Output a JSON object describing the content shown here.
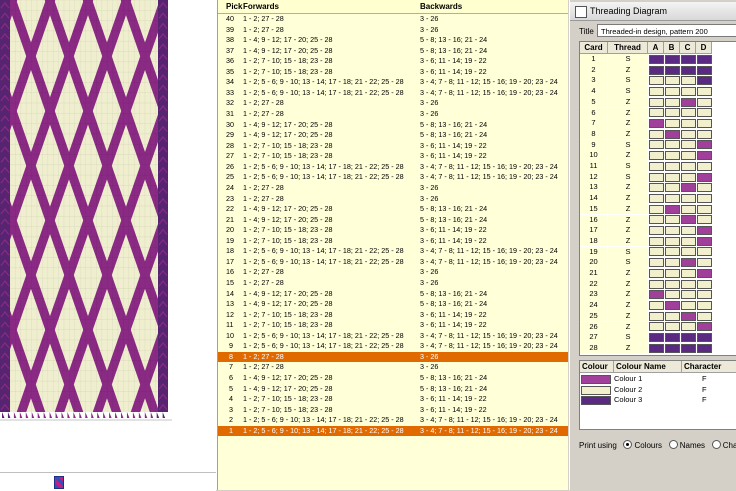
{
  "pattern": {
    "colors": {
      "purple": "#8a2a84",
      "cream": "#efefcf",
      "darkPurple": "#562470",
      "outline": "#5a2050"
    }
  },
  "picks_header": {
    "pick": "Pick",
    "forwards": "Forwards",
    "backwards": "Backwards"
  },
  "picks": [
    {
      "pick": "40",
      "fw": "1 - 2; 27 - 28",
      "bw": "3 - 26",
      "selected": false
    },
    {
      "pick": "39",
      "fw": "1 - 2; 27 - 28",
      "bw": "3 - 26",
      "selected": false
    },
    {
      "pick": "38",
      "fw": "1 - 4; 9 - 12; 17 - 20; 25 - 28",
      "bw": "5 - 8; 13 - 16; 21 - 24",
      "selected": false
    },
    {
      "pick": "37",
      "fw": "1 - 4; 9 - 12; 17 - 20; 25 - 28",
      "bw": "5 - 8; 13 - 16; 21 - 24",
      "selected": false
    },
    {
      "pick": "36",
      "fw": "1 - 2; 7 - 10; 15 - 18; 23 - 28",
      "bw": "3 - 6; 11 - 14; 19 - 22",
      "selected": false
    },
    {
      "pick": "35",
      "fw": "1 - 2; 7 - 10; 15 - 18; 23 - 28",
      "bw": "3 - 6; 11 - 14; 19 - 22",
      "selected": false
    },
    {
      "pick": "34",
      "fw": "1 - 2; 5 - 6; 9 - 10; 13 - 14; 17 - 18; 21 - 22; 25 - 28",
      "bw": "3 - 4; 7 - 8; 11 - 12; 15 - 16; 19 - 20; 23 - 24",
      "selected": false
    },
    {
      "pick": "33",
      "fw": "1 - 2; 5 - 6; 9 - 10; 13 - 14; 17 - 18; 21 - 22; 25 - 28",
      "bw": "3 - 4; 7 - 8; 11 - 12; 15 - 16; 19 - 20; 23 - 24",
      "selected": false
    },
    {
      "pick": "32",
      "fw": "1 - 2; 27 - 28",
      "bw": "3 - 26",
      "selected": false
    },
    {
      "pick": "31",
      "fw": "1 - 2; 27 - 28",
      "bw": "3 - 26",
      "selected": false
    },
    {
      "pick": "30",
      "fw": "1 - 4; 9 - 12; 17 - 20; 25 - 28",
      "bw": "5 - 8; 13 - 16; 21 - 24",
      "selected": false
    },
    {
      "pick": "29",
      "fw": "1 - 4; 9 - 12; 17 - 20; 25 - 28",
      "bw": "5 - 8; 13 - 16; 21 - 24",
      "selected": false
    },
    {
      "pick": "28",
      "fw": "1 - 2; 7 - 10; 15 - 18; 23 - 28",
      "bw": "3 - 6; 11 - 14; 19 - 22",
      "selected": false
    },
    {
      "pick": "27",
      "fw": "1 - 2; 7 - 10; 15 - 18; 23 - 28",
      "bw": "3 - 6; 11 - 14; 19 - 22",
      "selected": false
    },
    {
      "pick": "26",
      "fw": "1 - 2; 5 - 6; 9 - 10; 13 - 14; 17 - 18; 21 - 22; 25 - 28",
      "bw": "3 - 4; 7 - 8; 11 - 12; 15 - 16; 19 - 20; 23 - 24",
      "selected": false
    },
    {
      "pick": "25",
      "fw": "1 - 2; 5 - 6; 9 - 10; 13 - 14; 17 - 18; 21 - 22; 25 - 28",
      "bw": "3 - 4; 7 - 8; 11 - 12; 15 - 16; 19 - 20; 23 - 24",
      "selected": false
    },
    {
      "pick": "24",
      "fw": "1 - 2; 27 - 28",
      "bw": "3 - 26",
      "selected": false
    },
    {
      "pick": "23",
      "fw": "1 - 2; 27 - 28",
      "bw": "3 - 26",
      "selected": false
    },
    {
      "pick": "22",
      "fw": "1 - 4; 9 - 12; 17 - 20; 25 - 28",
      "bw": "5 - 8; 13 - 16; 21 - 24",
      "selected": false
    },
    {
      "pick": "21",
      "fw": "1 - 4; 9 - 12; 17 - 20; 25 - 28",
      "bw": "5 - 8; 13 - 16; 21 - 24",
      "selected": false
    },
    {
      "pick": "20",
      "fw": "1 - 2; 7 - 10; 15 - 18; 23 - 28",
      "bw": "3 - 6; 11 - 14; 19 - 22",
      "selected": false
    },
    {
      "pick": "19",
      "fw": "1 - 2; 7 - 10; 15 - 18; 23 - 28",
      "bw": "3 - 6; 11 - 14; 19 - 22",
      "selected": false
    },
    {
      "pick": "18",
      "fw": "1 - 2; 5 - 6; 9 - 10; 13 - 14; 17 - 18; 21 - 22; 25 - 28",
      "bw": "3 - 4; 7 - 8; 11 - 12; 15 - 16; 19 - 20; 23 - 24",
      "selected": false
    },
    {
      "pick": "17",
      "fw": "1 - 2; 5 - 6; 9 - 10; 13 - 14; 17 - 18; 21 - 22; 25 - 28",
      "bw": "3 - 4; 7 - 8; 11 - 12; 15 - 16; 19 - 20; 23 - 24",
      "selected": false
    },
    {
      "pick": "16",
      "fw": "1 - 2; 27 - 28",
      "bw": "3 - 26",
      "selected": false
    },
    {
      "pick": "15",
      "fw": "1 - 2; 27 - 28",
      "bw": "3 - 26",
      "selected": false
    },
    {
      "pick": "14",
      "fw": "1 - 4; 9 - 12; 17 - 20; 25 - 28",
      "bw": "5 - 8; 13 - 16; 21 - 24",
      "selected": false
    },
    {
      "pick": "13",
      "fw": "1 - 4; 9 - 12; 17 - 20; 25 - 28",
      "bw": "5 - 8; 13 - 16; 21 - 24",
      "selected": false
    },
    {
      "pick": "12",
      "fw": "1 - 2; 7 - 10; 15 - 18; 23 - 28",
      "bw": "3 - 6; 11 - 14; 19 - 22",
      "selected": false
    },
    {
      "pick": "11",
      "fw": "1 - 2; 7 - 10; 15 - 18; 23 - 28",
      "bw": "3 - 6; 11 - 14; 19 - 22",
      "selected": false
    },
    {
      "pick": "10",
      "fw": "1 - 2; 5 - 6; 9 - 10; 13 - 14; 17 - 18; 21 - 22; 25 - 28",
      "bw": "3 - 4; 7 - 8; 11 - 12; 15 - 16; 19 - 20; 23 - 24",
      "selected": false
    },
    {
      "pick": "9",
      "fw": "1 - 2; 5 - 6; 9 - 10; 13 - 14; 17 - 18; 21 - 22; 25 - 28",
      "bw": "3 - 4; 7 - 8; 11 - 12; 15 - 16; 19 - 20; 23 - 24",
      "selected": false
    },
    {
      "pick": "8",
      "fw": "1 - 2; 27 - 28",
      "bw": "3 - 26",
      "selected": true
    },
    {
      "pick": "7",
      "fw": "1 - 2; 27 - 28",
      "bw": "3 - 26",
      "selected": false
    },
    {
      "pick": "6",
      "fw": "1 - 4; 9 - 12; 17 - 20; 25 - 28",
      "bw": "5 - 8; 13 - 16; 21 - 24",
      "selected": false
    },
    {
      "pick": "5",
      "fw": "1 - 4; 9 - 12; 17 - 20; 25 - 28",
      "bw": "5 - 8; 13 - 16; 21 - 24",
      "selected": false
    },
    {
      "pick": "4",
      "fw": "1 - 2; 7 - 10; 15 - 18; 23 - 28",
      "bw": "3 - 6; 11 - 14; 19 - 22",
      "selected": false
    },
    {
      "pick": "3",
      "fw": "1 - 2; 7 - 10; 15 - 18; 23 - 28",
      "bw": "3 - 6; 11 - 14; 19 - 22",
      "selected": false
    },
    {
      "pick": "2",
      "fw": "1 - 2; 5 - 6; 9 - 10; 13 - 14; 17 - 18; 21 - 22; 25 - 28",
      "bw": "3 - 4; 7 - 8; 11 - 12; 15 - 16; 19 - 20; 23 - 24",
      "selected": false
    },
    {
      "pick": "1",
      "fw": "1 - 2; 5 - 6; 9 - 10; 13 - 14; 17 - 18; 21 - 22; 25 - 28",
      "bw": "3 - 4; 7 - 8; 11 - 12; 15 - 16; 19 - 20; 23 - 24",
      "selected": true
    }
  ],
  "threading": {
    "window_title": "Threading Diagram",
    "title_label": "Title",
    "title_value": "Threaded-in design, pattern 200",
    "headers": {
      "card": "Card",
      "thread": "Thread",
      "a": "A",
      "b": "B",
      "c": "C",
      "d": "D"
    },
    "palette": {
      "1": "#a0409a",
      "2": "#f2f0cc",
      "3": "#5a2a82"
    },
    "cards": [
      {
        "card": "1",
        "thread": "S",
        "holes": [
          3,
          3,
          3,
          3
        ]
      },
      {
        "card": "2",
        "thread": "Z",
        "holes": [
          3,
          3,
          3,
          3
        ]
      },
      {
        "card": "3",
        "thread": "S",
        "holes": [
          2,
          2,
          2,
          3
        ]
      },
      {
        "card": "4",
        "thread": "S",
        "holes": [
          2,
          2,
          2,
          2
        ]
      },
      {
        "card": "5",
        "thread": "Z",
        "holes": [
          2,
          2,
          1,
          2
        ]
      },
      {
        "card": "6",
        "thread": "Z",
        "holes": [
          2,
          2,
          2,
          2
        ]
      },
      {
        "card": "7",
        "thread": "Z",
        "holes": [
          1,
          2,
          2,
          2
        ]
      },
      {
        "card": "8",
        "thread": "Z",
        "holes": [
          2,
          1,
          2,
          2
        ]
      },
      {
        "card": "9",
        "thread": "S",
        "holes": [
          2,
          2,
          2,
          1
        ]
      },
      {
        "card": "10",
        "thread": "Z",
        "holes": [
          2,
          2,
          2,
          1
        ]
      },
      {
        "card": "11",
        "thread": "S",
        "holes": [
          2,
          2,
          2,
          2
        ]
      },
      {
        "card": "12",
        "thread": "S",
        "holes": [
          2,
          2,
          2,
          1
        ]
      },
      {
        "card": "13",
        "thread": "Z",
        "holes": [
          2,
          2,
          1,
          2
        ]
      },
      {
        "card": "14",
        "thread": "Z",
        "holes": [
          2,
          2,
          2,
          2
        ]
      },
      {
        "card": "15",
        "thread": "Z",
        "holes": [
          2,
          1,
          2,
          2
        ]
      },
      {
        "card": "16",
        "thread": "Z",
        "holes": [
          2,
          2,
          1,
          2
        ]
      },
      {
        "card": "17",
        "thread": "Z",
        "holes": [
          2,
          2,
          2,
          1
        ]
      },
      {
        "card": "18",
        "thread": "Z",
        "holes": [
          2,
          2,
          2,
          1
        ]
      },
      {
        "card": "19",
        "thread": "S",
        "holes": [
          2,
          2,
          2,
          2
        ]
      },
      {
        "card": "20",
        "thread": "S",
        "holes": [
          2,
          2,
          1,
          2
        ]
      },
      {
        "card": "21",
        "thread": "Z",
        "holes": [
          2,
          2,
          2,
          1
        ]
      },
      {
        "card": "22",
        "thread": "Z",
        "holes": [
          2,
          2,
          2,
          2
        ]
      },
      {
        "card": "23",
        "thread": "Z",
        "holes": [
          1,
          2,
          2,
          2
        ]
      },
      {
        "card": "24",
        "thread": "Z",
        "holes": [
          2,
          1,
          2,
          2
        ]
      },
      {
        "card": "25",
        "thread": "Z",
        "holes": [
          2,
          2,
          1,
          2
        ]
      },
      {
        "card": "26",
        "thread": "Z",
        "holes": [
          2,
          2,
          2,
          1
        ]
      },
      {
        "card": "27",
        "thread": "S",
        "holes": [
          3,
          3,
          3,
          3
        ]
      },
      {
        "card": "28",
        "thread": "Z",
        "holes": [
          3,
          3,
          3,
          3
        ]
      }
    ],
    "colour_headers": {
      "colour": "Colour",
      "name": "Colour Name",
      "character": "Character"
    },
    "colours": [
      {
        "key": "1",
        "name": "Colour 1",
        "char": "F"
      },
      {
        "key": "2",
        "name": "Colour 2",
        "char": "F"
      },
      {
        "key": "3",
        "name": "Colour 3",
        "char": "F"
      }
    ],
    "print_using": {
      "label": "Print using",
      "options": [
        "Colours",
        "Names",
        "Characters"
      ],
      "selected": "Colours"
    }
  }
}
